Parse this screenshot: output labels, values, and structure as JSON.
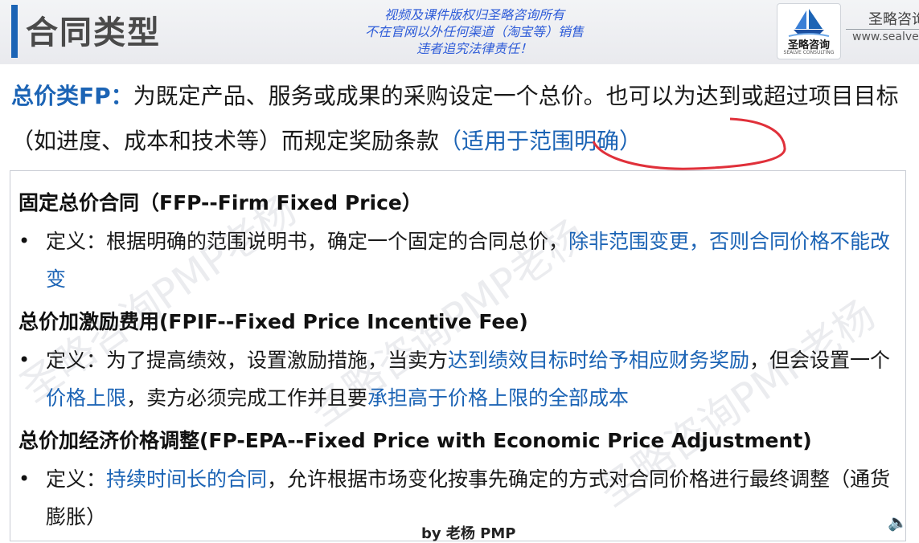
{
  "header": {
    "title": "合同类型",
    "copyright_lines": [
      "视频及课件版权归圣略咨询所有",
      "不在官网以外任何渠道（淘宝等）销售",
      "违者追究法律责任！"
    ],
    "logo_text": "圣略咨询",
    "logo_subtext": "SEALVE CONSULTING",
    "brand_name": "圣略咨询",
    "brand_url": "www.sealve"
  },
  "intro": {
    "lead": "总价类FP：",
    "text": "为既定产品、服务或成果的采购设定一个总价。也可以为达到或超过项目目标（如进度、成本和技术等）而规定奖励条款",
    "highlight": "（适用于范围明确）"
  },
  "sections": [
    {
      "heading": "固定总价合同（FFP--Firm Fixed Price）",
      "bullet": "•",
      "parts": [
        {
          "text": "定义：根据明确的范围说明书，确定一个固定的合同总价，",
          "hl": false
        },
        {
          "text": "除非范围变更，否则合同价格不能改变",
          "hl": true
        }
      ]
    },
    {
      "heading": "总价加激励费用(FPIF--Fixed Price Incentive Fee)",
      "bullet": "•",
      "parts": [
        {
          "text": "定义：为了提高绩效，设置激励措施，当卖方",
          "hl": false
        },
        {
          "text": "达到绩效目标时给予相应财务奖励",
          "hl": true
        },
        {
          "text": "，但会设置一个",
          "hl": false
        },
        {
          "text": "价格上限",
          "hl": true
        },
        {
          "text": "，卖方必须完成工作并且要",
          "hl": false
        },
        {
          "text": "承担高于价格上限的全部成本",
          "hl": true
        }
      ]
    },
    {
      "heading": "总价加经济价格调整(FP-EPA--Fixed Price with Economic Price Adjustment)",
      "bullet": "•",
      "parts": [
        {
          "text": "定义：",
          "hl": false
        },
        {
          "text": "持续时间长的合同",
          "hl": true
        },
        {
          "text": "，允许根据市场变化按事先确定的方式对合同价格进行最终调整（通货膨胀）",
          "hl": false
        }
      ]
    }
  ],
  "watermark_text": "圣略咨询PMP老杨",
  "byline": "by 老杨 PMP",
  "icons": {
    "logo": "ship-logo-icon",
    "speaker": "speaker-icon"
  },
  "colors": {
    "accent": "#1c64b5",
    "highlight_text": "#1c64b5",
    "copyright": "#2d5bd8",
    "annotation": "#e0303a"
  }
}
